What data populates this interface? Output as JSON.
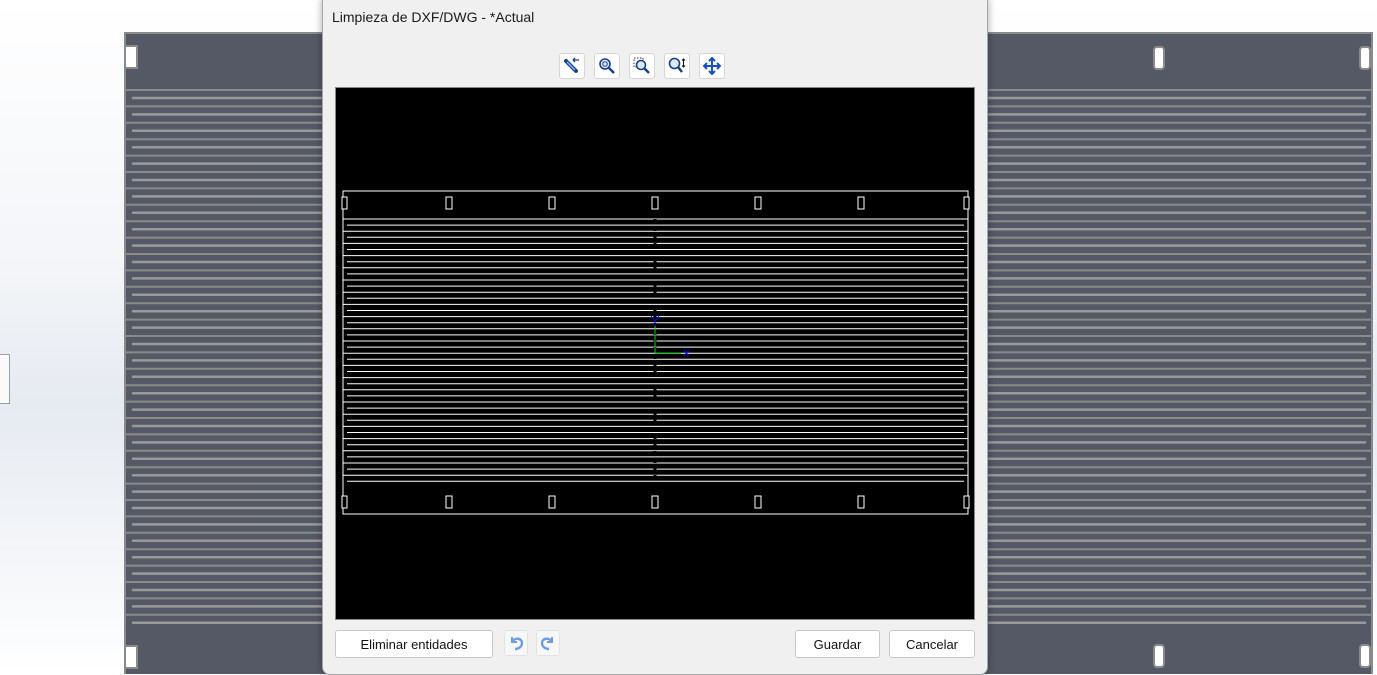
{
  "dialog": {
    "title": "Limpieza de DXF/DWG - *Actual",
    "toolbar": [
      {
        "icon": "select-entities-icon"
      },
      {
        "icon": "zoom-fit-icon"
      },
      {
        "icon": "zoom-window-icon"
      },
      {
        "icon": "zoom-in-out-icon"
      },
      {
        "icon": "pan-icon"
      }
    ],
    "buttons": {
      "delete_entities": "Eliminar entidades",
      "undo": "undo-icon",
      "redo": "redo-icon",
      "save": "Guardar",
      "cancel": "Cancelar"
    }
  },
  "colors": {
    "preview_background": "#000000",
    "preview_lines": "#ffffff",
    "part_fill": "#555966",
    "part_edges": "#8a8a8a",
    "axis_x": "#00d000",
    "axis_y": "#0000ff"
  }
}
